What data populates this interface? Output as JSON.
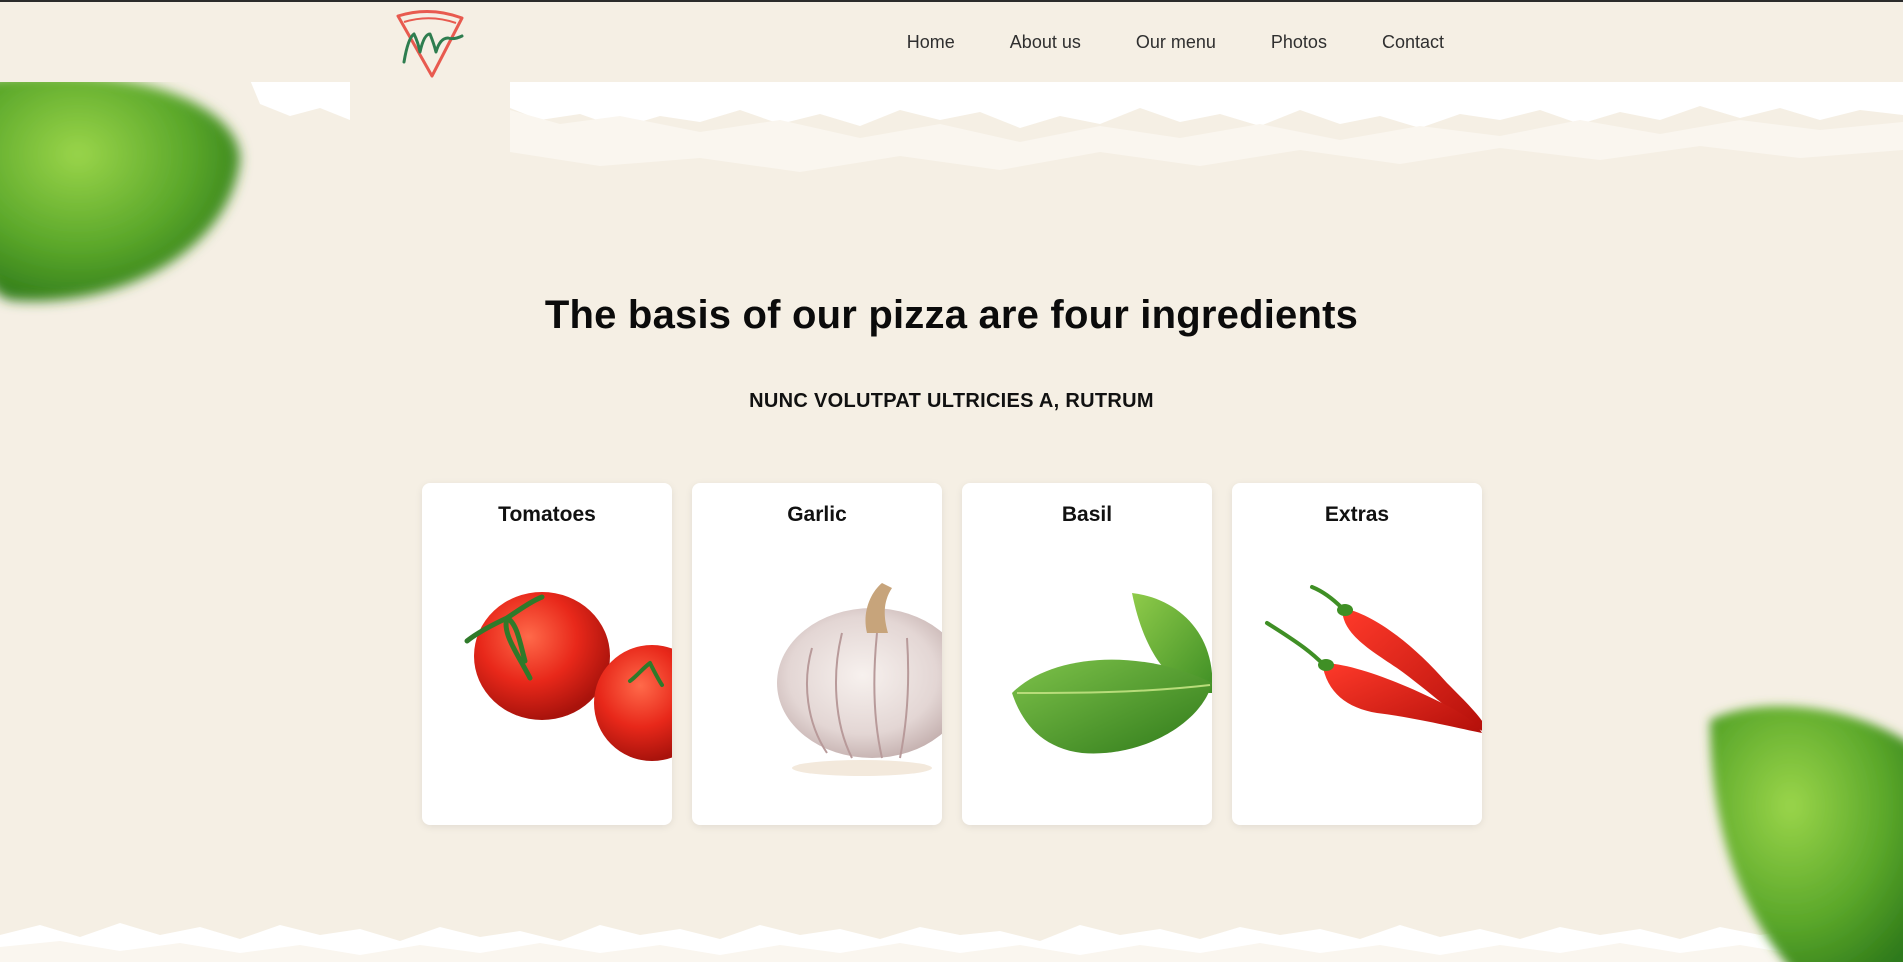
{
  "header": {
    "logo_icon": "pizza-slice-m-logo-icon",
    "nav": [
      {
        "label": "Home"
      },
      {
        "label": "About us"
      },
      {
        "label": "Our menu"
      },
      {
        "label": "Photos"
      },
      {
        "label": "Contact"
      }
    ]
  },
  "main": {
    "title": "The basis of our pizza are four ingredients",
    "subtitle": "NUNC VOLUTPAT ULTRICIES A, RUTRUM",
    "cards": [
      {
        "title": "Tomatoes",
        "image": "tomatoes-image"
      },
      {
        "title": "Garlic",
        "image": "garlic-image"
      },
      {
        "title": "Basil",
        "image": "basil-image"
      },
      {
        "title": "Extras",
        "image": "chili-peppers-image"
      }
    ]
  },
  "colors": {
    "background": "#f5efe4",
    "logo_red": "#e85a4f",
    "logo_green": "#2e7d4f",
    "leaf_green": "#5fae2e"
  }
}
